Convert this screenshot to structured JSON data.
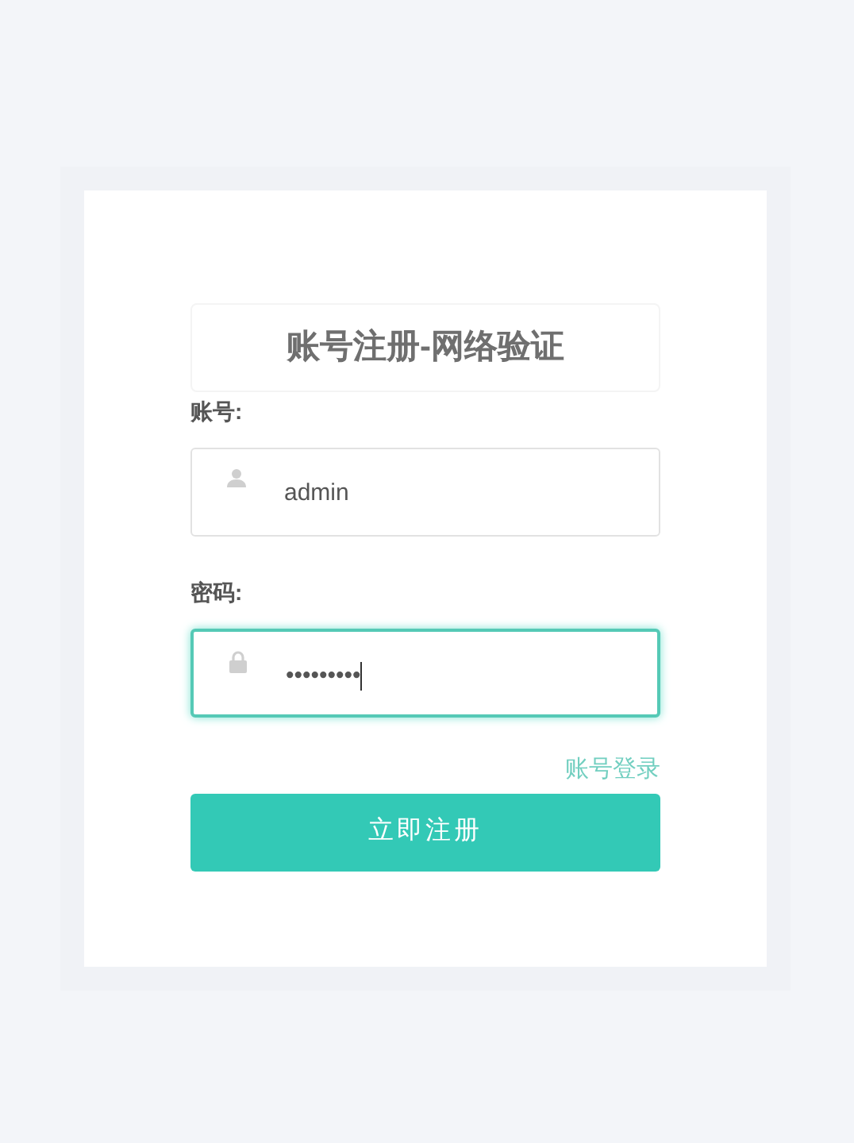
{
  "title": "账号注册-网络验证",
  "fields": [
    {
      "label": "账号:",
      "kind": "user",
      "value": "admin",
      "focused": false
    },
    {
      "label": "密码:",
      "kind": "password",
      "value": "•••••••••",
      "focused": true
    }
  ],
  "link": "账号登录",
  "submit": "立即注册"
}
